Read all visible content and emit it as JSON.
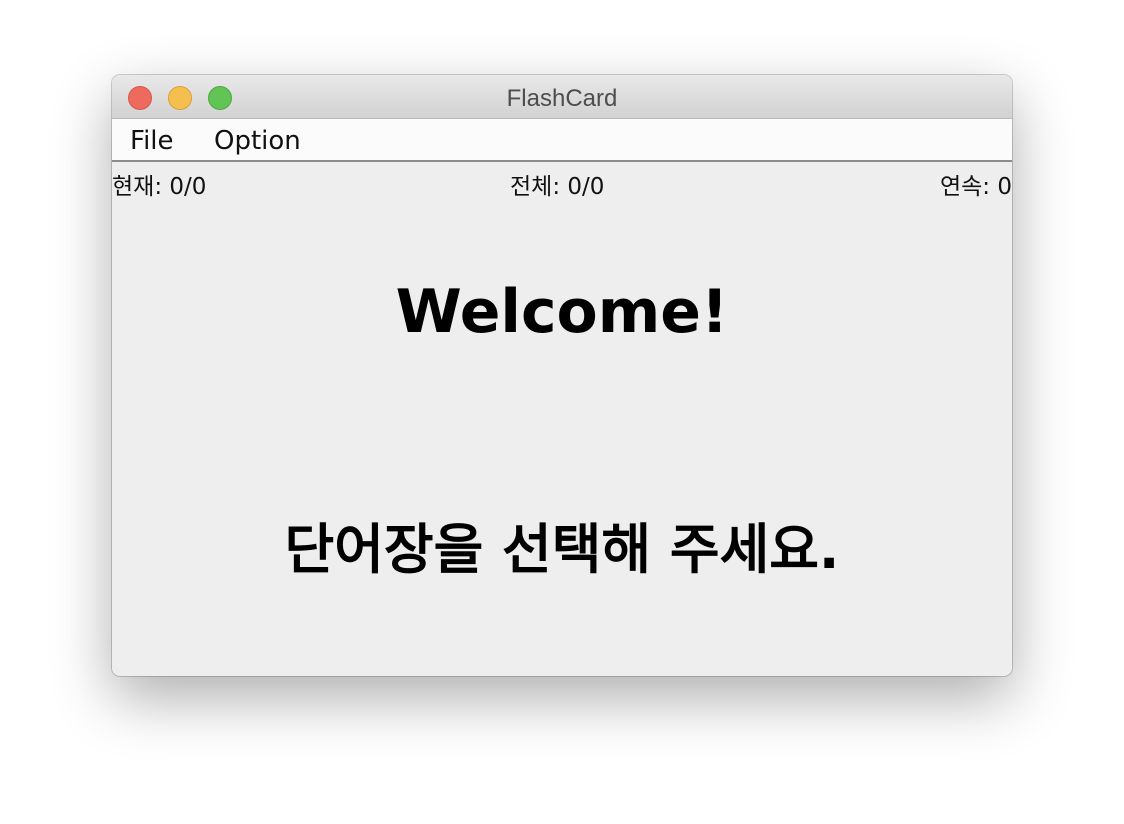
{
  "window": {
    "title": "FlashCard",
    "controls": {
      "close_color": "#ee6a5e",
      "minimize_color": "#f5bf4f",
      "zoom_color": "#61c454"
    }
  },
  "menubar": {
    "items": [
      {
        "label": "File"
      },
      {
        "label": "Option"
      }
    ]
  },
  "status": {
    "current": "현재: 0/0",
    "total": "전체: 0/0",
    "streak": "연속: 0"
  },
  "main": {
    "welcome": "Welcome!",
    "prompt": "단어장을 선택해 주세요."
  }
}
